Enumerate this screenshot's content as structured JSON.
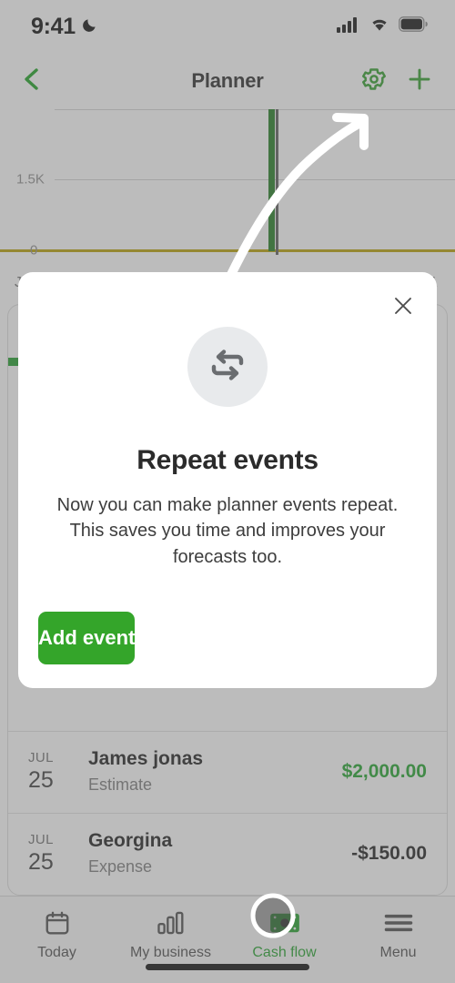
{
  "status_bar": {
    "time": "9:41",
    "dnd_icon": "moon-icon",
    "signal_icon": "cellular-signal-icon",
    "wifi_icon": "wifi-icon",
    "battery_icon": "battery-icon"
  },
  "header": {
    "back_icon": "chevron-left-icon",
    "title": "Planner",
    "settings_icon": "gear-icon",
    "add_icon": "plus-icon",
    "accent_color": "#2f9e2a"
  },
  "chart": {
    "y_labels": [
      "1.5K",
      "0"
    ],
    "x_label_left": "Ju",
    "x_label_right": "1",
    "zero_line_color": "#b8a000",
    "bar_color": "#1e7a1e"
  },
  "coach_arrow": {
    "icon": "curved-arrow-up-right-icon",
    "color": "#ffffff"
  },
  "modal": {
    "close_icon": "close-icon",
    "badge_icon": "repeat-icon",
    "title": "Repeat events",
    "body": "Now you can make planner events repeat. This saves you time and improves your forecasts too.",
    "cta_label": "Add event",
    "cta_color": "#34a52a"
  },
  "events": [
    {
      "month": "JUL",
      "day": "25",
      "name": "James jonas",
      "type": "Estimate",
      "amount": "$2,000.00",
      "amount_color": "#1fa32a"
    },
    {
      "month": "JUL",
      "day": "25",
      "name": "Georgina",
      "type": "Expense",
      "amount": "-$150.00",
      "amount_color": "#1c1c1c"
    }
  ],
  "tabbar": {
    "items": [
      {
        "label": "Today",
        "icon": "calendar-icon",
        "active": false
      },
      {
        "label": "My business",
        "icon": "bar-chart-icon",
        "active": false
      },
      {
        "label": "Cash flow",
        "icon": "money-bill-icon",
        "active": true
      },
      {
        "label": "Menu",
        "icon": "hamburger-menu-icon",
        "active": false
      }
    ]
  },
  "touch_indicator": {
    "name": "tap-highlight-ring",
    "target": "Cash flow"
  }
}
